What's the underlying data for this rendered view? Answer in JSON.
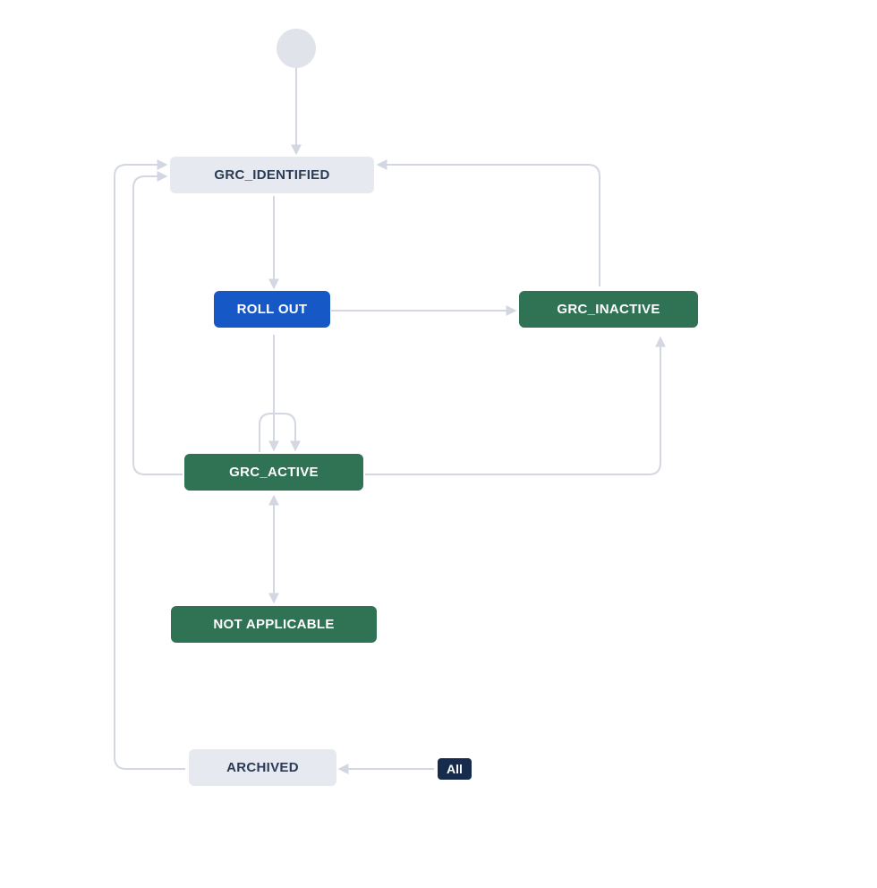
{
  "diagram": {
    "nodes": {
      "start": {
        "type": "start"
      },
      "identified": {
        "label": "GRC_IDENTIFIED",
        "style": "grey"
      },
      "rollout": {
        "label": "ROLL OUT",
        "style": "blue"
      },
      "inactive": {
        "label": "GRC_INACTIVE",
        "style": "green"
      },
      "active": {
        "label": "GRC_ACTIVE",
        "style": "green"
      },
      "notapplicable": {
        "label": "NOT APPLICABLE",
        "style": "green"
      },
      "archived": {
        "label": "ARCHIVED",
        "style": "grey"
      },
      "all": {
        "label": "All",
        "style": "pill"
      }
    },
    "edges": [
      {
        "from": "start",
        "to": "identified"
      },
      {
        "from": "identified",
        "to": "rollout"
      },
      {
        "from": "rollout",
        "to": "inactive"
      },
      {
        "from": "rollout",
        "to": "active"
      },
      {
        "from": "active",
        "to": "active"
      },
      {
        "from": "active",
        "to": "identified"
      },
      {
        "from": "active",
        "to": "inactive"
      },
      {
        "from": "active",
        "to": "notapplicable",
        "bidirectional": true
      },
      {
        "from": "inactive",
        "to": "identified"
      },
      {
        "from": "all",
        "to": "archived"
      },
      {
        "from": "archived",
        "to": "identified"
      }
    ],
    "colors": {
      "grey_bg": "#e6e9ef",
      "grey_text": "#2a3b55",
      "blue": "#1758c7",
      "green": "#2f7254",
      "pill": "#172b4d",
      "edge": "#d2d7e1"
    }
  }
}
